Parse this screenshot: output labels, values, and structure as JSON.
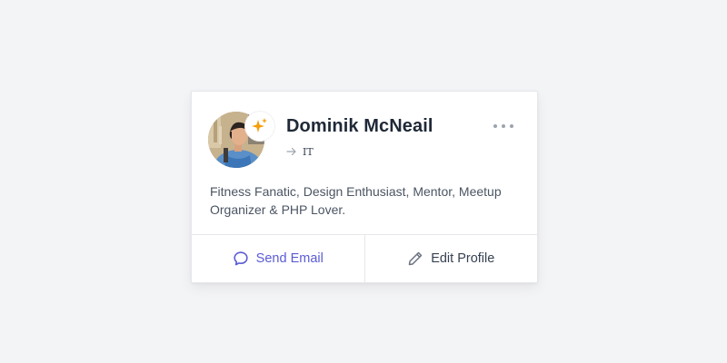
{
  "profile": {
    "name": "Dominik McNeail",
    "role": "IT",
    "bio": "Fitness Fanatic, Design Enthusiast, Mentor, Meetup Organizer & PHP Lover."
  },
  "actions": {
    "send_email": "Send Email",
    "edit_profile": "Edit Profile"
  },
  "icons": {
    "badge": "sparkles-icon",
    "role": "arrow-right-icon",
    "more": "more-horizontal-icon",
    "email": "chat-bubble-icon",
    "edit": "pencil-icon"
  },
  "colors": {
    "accent": "#5b5bd6",
    "badge": "#f59e0b",
    "background": "#f3f4f6"
  }
}
